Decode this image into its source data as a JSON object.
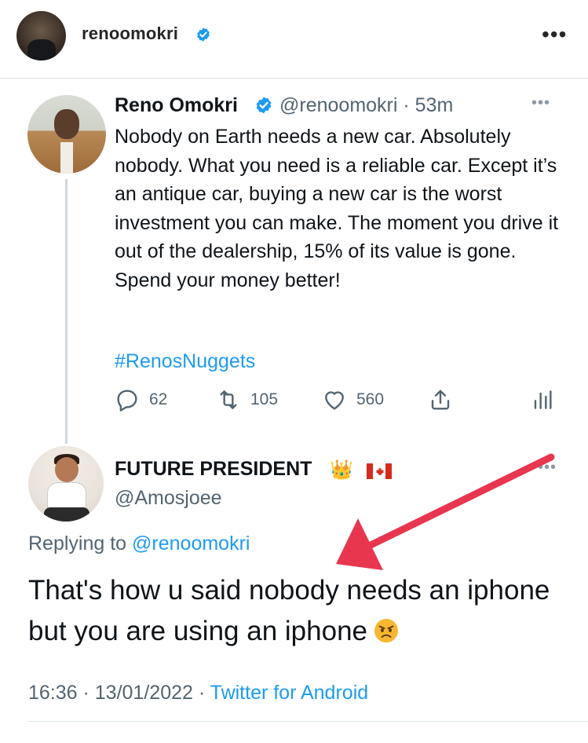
{
  "post": {
    "username": "renoomokri",
    "more_label": "•••"
  },
  "tweet1": {
    "name": "Reno Omokri",
    "handle": "@renoomokri · 53m",
    "more_label": "•••",
    "text": "Nobody on Earth needs a new car. Absolutely nobody. What you need is a reliable car. Except it’s an antique car, buying a new car is the worst investment you can make. The moment you drive it out of the dealership, 15% of its value is gone. Spend your money better!",
    "hashtag": "#RenosNuggets",
    "actions": {
      "replies": "62",
      "retweets": "105",
      "likes": "560"
    }
  },
  "tweet2": {
    "name": "FUTURE PRESIDENT",
    "crown_emoji": "👑",
    "handle": "@Amosjoee",
    "more_label": "•••",
    "replying_prefix": "Replying to ",
    "replying_mention": "@renoomokri",
    "text": "That's how u said nobody needs an iphone but you are using an iphone",
    "time": "16:36 · 13/01/2022 · ",
    "source": "Twitter for Android"
  },
  "colors": {
    "link": "#1d9bf0",
    "secondary_text": "#536471",
    "arrow": "#e8364f",
    "verified": "#1d9bf0"
  },
  "icons": {
    "header_verified": "verified-badge-icon",
    "reply": "reply-icon",
    "retweet": "retweet-icon",
    "like": "heart-icon",
    "share": "share-icon",
    "stats": "analytics-icon",
    "flag": "canada-flag-icon",
    "angry": "angry-face-icon"
  }
}
